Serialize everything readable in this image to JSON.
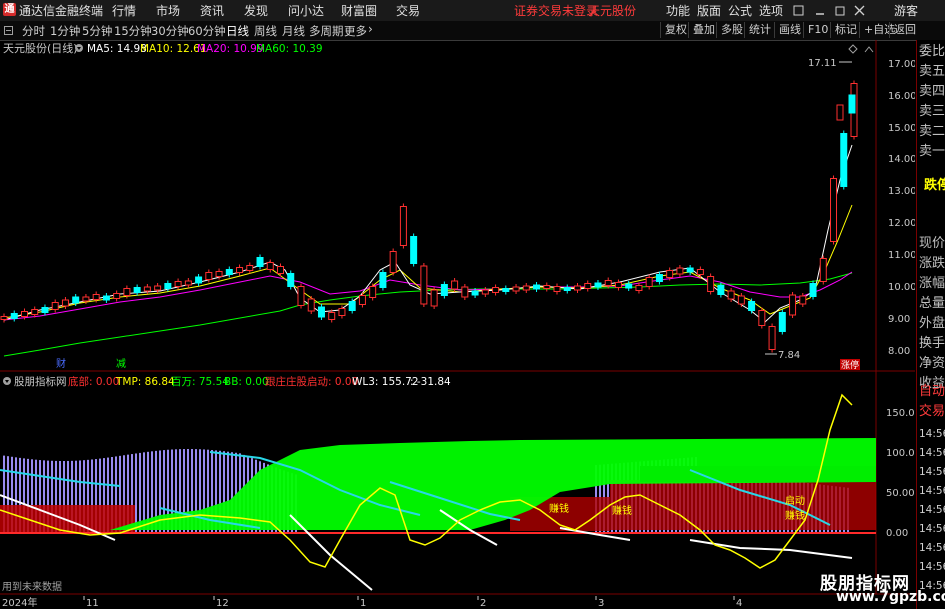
{
  "titlebar": {
    "app_name": "通达信金融终端",
    "menu": [
      "行情",
      "市场",
      "资讯",
      "发现",
      "问小达",
      "财富圈",
      "交易"
    ],
    "warning": "证券交易未登录",
    "stock_name": "天元股份",
    "right_menu": [
      "功能",
      "版面",
      "公式",
      "选项"
    ],
    "user": "游客",
    "window_controls": [
      "minimize-icon",
      "restore-icon",
      "close-icon"
    ]
  },
  "toolbar": {
    "periods": [
      "分时",
      "1分钟",
      "5分钟",
      "15分钟",
      "30分钟",
      "60分钟",
      "日线",
      "周线",
      "月线",
      "多周期",
      "更多"
    ],
    "selected_period": "日线",
    "right_buttons": [
      "复权",
      "叠加",
      "多股",
      "统计",
      "画线",
      "F10",
      "标记",
      "+自选",
      "返回"
    ]
  },
  "main_chart": {
    "title": "天元股份(日线)",
    "ma": [
      {
        "label": "MA5: 14.98",
        "color": "#ffffff"
      },
      {
        "label": "MA10: 12.61",
        "color": "#ffff00"
      },
      {
        "label": "MA20: 10.99",
        "color": "#ff00ff"
      },
      {
        "label": "MA60: 10.39",
        "color": "#00ff00"
      }
    ],
    "y_ticks": [
      "17.00",
      "16.00",
      "15.00",
      "14.00",
      "13.00",
      "12.00",
      "11.00",
      "10.00",
      "9.00",
      "8.00"
    ],
    "high_label": "17.11",
    "low_label": "7.84",
    "markers": [
      "财",
      "减"
    ],
    "right_marker": "涨停"
  },
  "indicator": {
    "name": "股朋指标网",
    "items": [
      {
        "label": "底部: 0.00",
        "color": "#ff3030"
      },
      {
        "label": "TMP: 86.84",
        "color": "#ffff00"
      },
      {
        "label": "百万: 75.54",
        "color": "#00ff00"
      },
      {
        "label": "BB: 0.00",
        "color": "#00ff00"
      },
      {
        "label": "跟庄庄股启动: 0.00",
        "color": "#ff3030"
      },
      {
        "label": "WL3: 155.72",
        "color": "#ffffff"
      },
      {
        "label": ": -31.84",
        "color": "#ffffff"
      }
    ],
    "y_ticks": [
      "150.0",
      "100.0",
      "50.00",
      "0.00"
    ],
    "signal_labels": [
      "赚钱",
      "赚钱",
      "启动",
      "赚钱"
    ],
    "footer_note": "用到未来数据"
  },
  "x_axis": {
    "labels": [
      "2024年",
      "11",
      "12",
      "1",
      "2",
      "3",
      "4"
    ]
  },
  "right_panel": {
    "items": [
      "委比",
      "卖五",
      "卖四",
      "卖三",
      "卖二",
      "卖一",
      "",
      "跌停",
      "",
      "现价",
      "涨跌",
      "涨幅",
      "总量",
      "外盘",
      "换手",
      "净资",
      "收益",
      "自动",
      "交易",
      "14:56",
      "14:56",
      "14:56",
      "14:56",
      "14:56",
      "14:56",
      "14:56",
      "14:56",
      "14:56"
    ]
  },
  "watermark": {
    "line1": "股朋指标网",
    "line2": "www.7gpzb.com"
  }
}
